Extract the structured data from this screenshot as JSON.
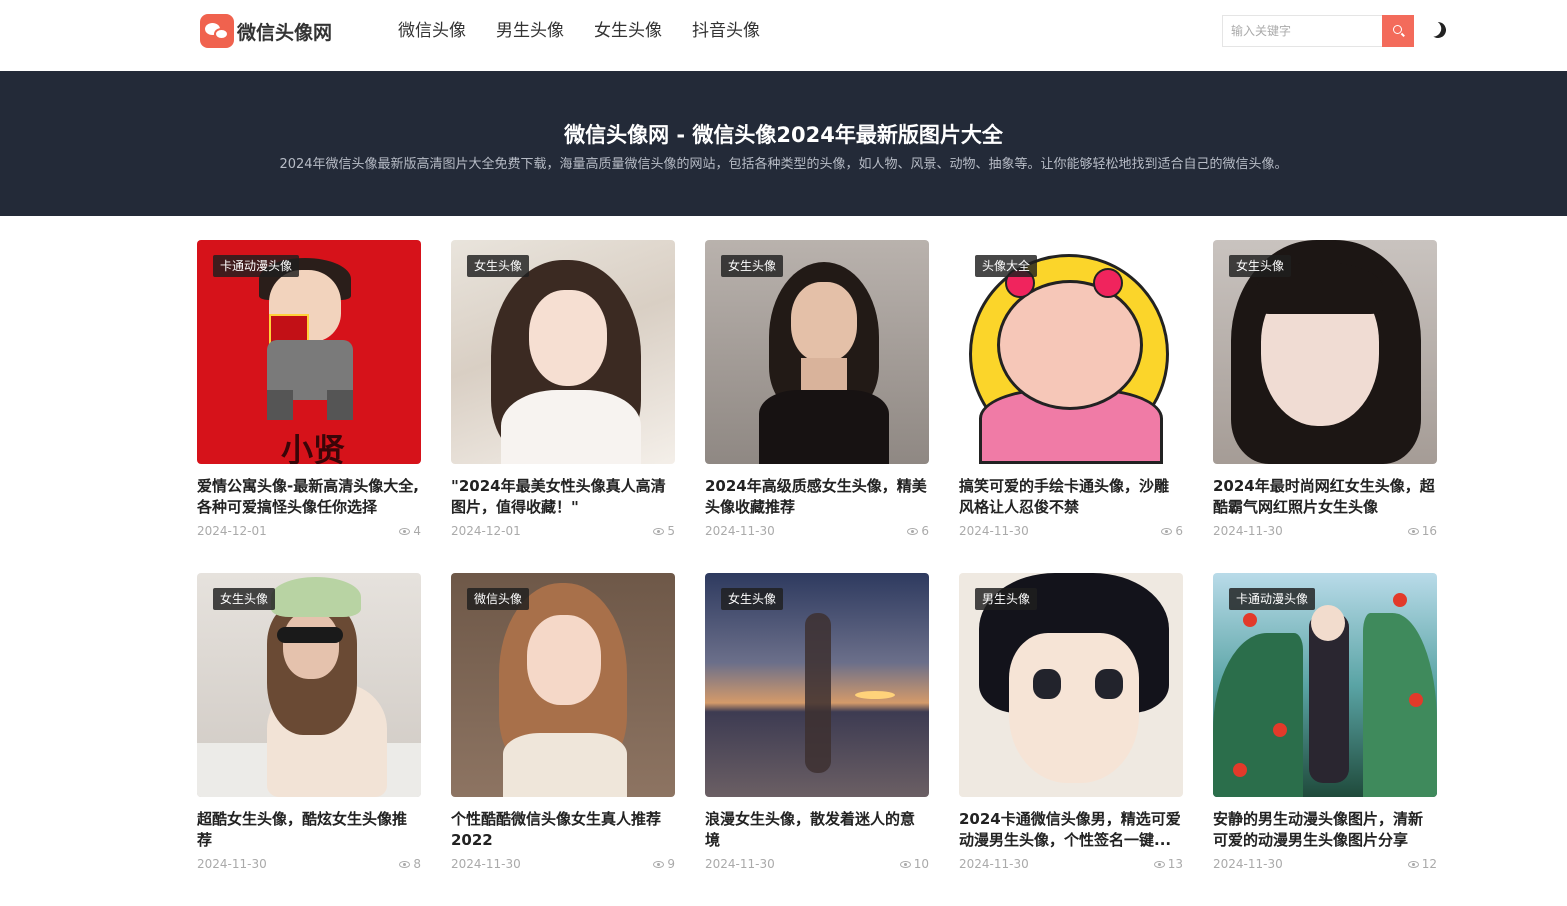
{
  "header": {
    "logo_text": "微信头像网",
    "nav": [
      "微信头像",
      "男生头像",
      "女生头像",
      "抖音头像"
    ],
    "search_placeholder": "输入关键字"
  },
  "banner": {
    "title": "微信头像网 - 微信头像2024年最新版图片大全",
    "subtitle": "2024年微信头像最新版高清图片大全免费下载，海量高质量微信头像的网站，包括各种类型的头像，如人物、风景、动物、抽象等。让你能够轻松地找到适合自己的微信头像。"
  },
  "cards": [
    {
      "tag": "卡通动漫头像",
      "title": "爱情公寓头像-最新高清头像大全,各种可爱搞怪头像任你选择",
      "date": "2024-12-01",
      "views": "4",
      "art": "a-red",
      "art_text": "小贤"
    },
    {
      "tag": "女生头像",
      "title": "\"2024年最美女性头像真人高清图片，值得收藏！\"",
      "date": "2024-12-01",
      "views": "5",
      "art": "a-girl1"
    },
    {
      "tag": "女生头像",
      "title": "2024年高级质感女生头像，精美头像收藏推荐",
      "date": "2024-11-30",
      "views": "6",
      "art": "a-girl2"
    },
    {
      "tag": "头像大全",
      "title": "搞笑可爱的手绘卡通头像，沙雕风格让人忍俊不禁",
      "date": "2024-11-30",
      "views": "6",
      "art": "a-cartoon"
    },
    {
      "tag": "女生头像",
      "title": "2024年最时尚网红女生头像，超酷霸气网红照片女生头像",
      "date": "2024-11-30",
      "views": "16",
      "art": "a-girl3"
    },
    {
      "tag": "女生头像",
      "title": "超酷女生头像，酷炫女生头像推荐",
      "date": "2024-11-30",
      "views": "8",
      "art": "a-girl4"
    },
    {
      "tag": "微信头像",
      "title": "个性酷酷微信头像女生真人推荐2022",
      "date": "2024-11-30",
      "views": "9",
      "art": "a-girl5"
    },
    {
      "tag": "女生头像",
      "title": "浪漫女生头像，散发着迷人的意境",
      "date": "2024-11-30",
      "views": "10",
      "art": "a-beach"
    },
    {
      "tag": "男生头像",
      "title": "2024卡通微信头像男，精选可爱动漫男生头像，个性签名一键...",
      "date": "2024-11-30",
      "views": "13",
      "art": "a-anime"
    },
    {
      "tag": "卡通动漫头像",
      "title": "安静的男生动漫头像图片，清新可爱的动漫男生头像图片分享",
      "date": "2024-11-30",
      "views": "12",
      "art": "a-jungle"
    }
  ]
}
